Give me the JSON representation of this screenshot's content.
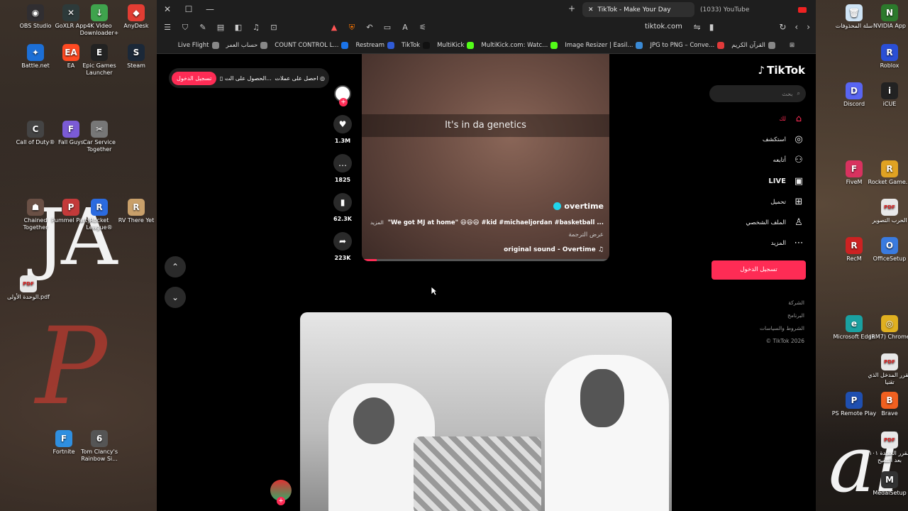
{
  "desktop": {
    "left_icons": [
      {
        "label": "OBS Studio",
        "color": "#302e31",
        "glyph": "◉"
      },
      {
        "label": "GoXLR App",
        "color": "#2d3a3a",
        "glyph": "✕"
      },
      {
        "label": "4K Video Downloader+",
        "color": "#3fa34d",
        "glyph": "↓"
      },
      {
        "label": "AnyDesk",
        "color": "#e23d33",
        "glyph": "◆"
      },
      {
        "label": "Battle.net",
        "color": "#1c6fd6",
        "glyph": "✦"
      },
      {
        "label": "EA",
        "color": "#ff4a22",
        "glyph": "EA"
      },
      {
        "label": "Epic Games Launcher",
        "color": "#222222",
        "glyph": "E"
      },
      {
        "label": "Steam",
        "color": "#1b2838",
        "glyph": "S"
      },
      {
        "label": "Call of Duty®",
        "color": "#444444",
        "glyph": "C"
      },
      {
        "label": "Fall Guys",
        "color": "#7b5bd6",
        "glyph": "F"
      },
      {
        "label": "Car Service Together",
        "color": "#777777",
        "glyph": "✂"
      },
      {
        "label": "Chained Together",
        "color": "#6a5045",
        "glyph": "☗"
      },
      {
        "label": "Pummel Party",
        "color": "#c33a3a",
        "glyph": "P"
      },
      {
        "label": "Rocket League®",
        "color": "#2b6be0",
        "glyph": "R"
      },
      {
        "label": "RV There Yet",
        "color": "#c9a06a",
        "glyph": "R"
      },
      {
        "label": "الوحدة الأولى.pdf",
        "color": "#e8e8e8",
        "glyph": "PDF"
      },
      {
        "label": "Fortnite",
        "color": "#2f8fe0",
        "glyph": "F"
      },
      {
        "label": "Tom Clancy's Rainbow Si...",
        "color": "#555555",
        "glyph": "6"
      }
    ],
    "right_icons": [
      {
        "label": "سلة المحذوفات",
        "color": "#cfe4f5",
        "glyph": "🗑"
      },
      {
        "label": "NVIDIA App",
        "color": "#2c7a2c",
        "glyph": "N"
      },
      {
        "label": "Roblox",
        "color": "#2a4fd6",
        "glyph": "R"
      },
      {
        "label": "Discord",
        "color": "#5865f2",
        "glyph": "D"
      },
      {
        "label": "iCUE",
        "color": "#222222",
        "glyph": "i"
      },
      {
        "label": "FiveM",
        "color": "#d8325f",
        "glyph": "F"
      },
      {
        "label": "Rocket Game...",
        "color": "#e0a222",
        "glyph": "R"
      },
      {
        "label": "الحرب التصوير",
        "color": "#e8e8e8",
        "glyph": "PDF"
      },
      {
        "label": "RecM",
        "color": "#c22",
        "glyph": "R"
      },
      {
        "label": "OfficeSetup",
        "color": "#3a7be0",
        "glyph": "O"
      },
      {
        "label": "Microsoft Edge",
        "color": "#1aa1a1",
        "glyph": "e"
      },
      {
        "label": "(RM7) Chrome",
        "color": "#e0b020",
        "glyph": "◎"
      },
      {
        "label": "مقرر المدخل الذي تقنيا",
        "color": "#e8e8e8",
        "glyph": "PDF"
      },
      {
        "label": "PS Remote Play",
        "color": "#1f4fb0",
        "glyph": "P"
      },
      {
        "label": "Brave",
        "color": "#f06020",
        "glyph": "B"
      },
      {
        "label": "مقرر العقيدة ١٠١ بعد التنقيح",
        "color": "#e8e8e8",
        "glyph": "PDF"
      },
      {
        "label": "MedalSetup",
        "color": "#333333",
        "glyph": "M"
      }
    ],
    "wallpaper_text_ja": "JA",
    "wallpaper_text_al": "al"
  },
  "browser": {
    "tabs": {
      "active": "TikTok - Make Your Day",
      "other": "(1033) YouTube"
    },
    "url": "tiktok.com",
    "bookmarks": [
      {
        "label": "Live Flight",
        "color": "#888888"
      },
      {
        "label": "حساب العمر",
        "color": "#888888"
      },
      {
        "label": "COUNT CONTROL L...",
        "color": "#1a73e8"
      },
      {
        "label": "Restream",
        "color": "#2f5bd6"
      },
      {
        "label": "TikTok",
        "color": "#111111"
      },
      {
        "label": "MultiKick",
        "color": "#53fc18"
      },
      {
        "label": "MultiKick.com: Watc...",
        "color": "#53fc18"
      },
      {
        "label": "Image Resizer | Easil...",
        "color": "#3a8ad6"
      },
      {
        "label": "JPG to PNG – Conve...",
        "color": "#e03a3a"
      },
      {
        "label": "القرآن الكريم",
        "color": "#888888"
      }
    ]
  },
  "tiktok": {
    "logo": "TikTok",
    "search_placeholder": "بحث",
    "top_actions": {
      "get_coins": "احصل على عملات",
      "get_app": "الحصول على الت...",
      "login": "تسجيل الدخول"
    },
    "nav": [
      {
        "label": "لك",
        "icon": "⌂",
        "active": true
      },
      {
        "label": "استكشف",
        "icon": "◎",
        "active": false
      },
      {
        "label": "أتابعه",
        "icon": "⚇",
        "active": false
      },
      {
        "label": "LIVE",
        "icon": "▣",
        "active": false
      },
      {
        "label": "تحميل",
        "icon": "⊞",
        "active": false
      },
      {
        "label": "الملف الشخصي",
        "icon": "♙",
        "active": false
      },
      {
        "label": "المزيد",
        "icon": "⋯",
        "active": false
      }
    ],
    "login_button": "تسجيل الدخول",
    "footer": [
      "الشركة",
      "البرنامج",
      "الشروط والسياسات",
      "© TikTok 2026"
    ],
    "video1": {
      "caption": "It's in da genetics",
      "username": "overtime",
      "description": "\"We got MJ at home\" 😆😆😆 #kid #michaeljordan #basketball ...",
      "more": "المزيد",
      "translate": "عرض الترجمة",
      "sound": "original sound - Overtime",
      "progress": 0.06,
      "likes": "1.3M",
      "comments": "1825",
      "saves": "62.3K",
      "shares": "223K"
    }
  }
}
